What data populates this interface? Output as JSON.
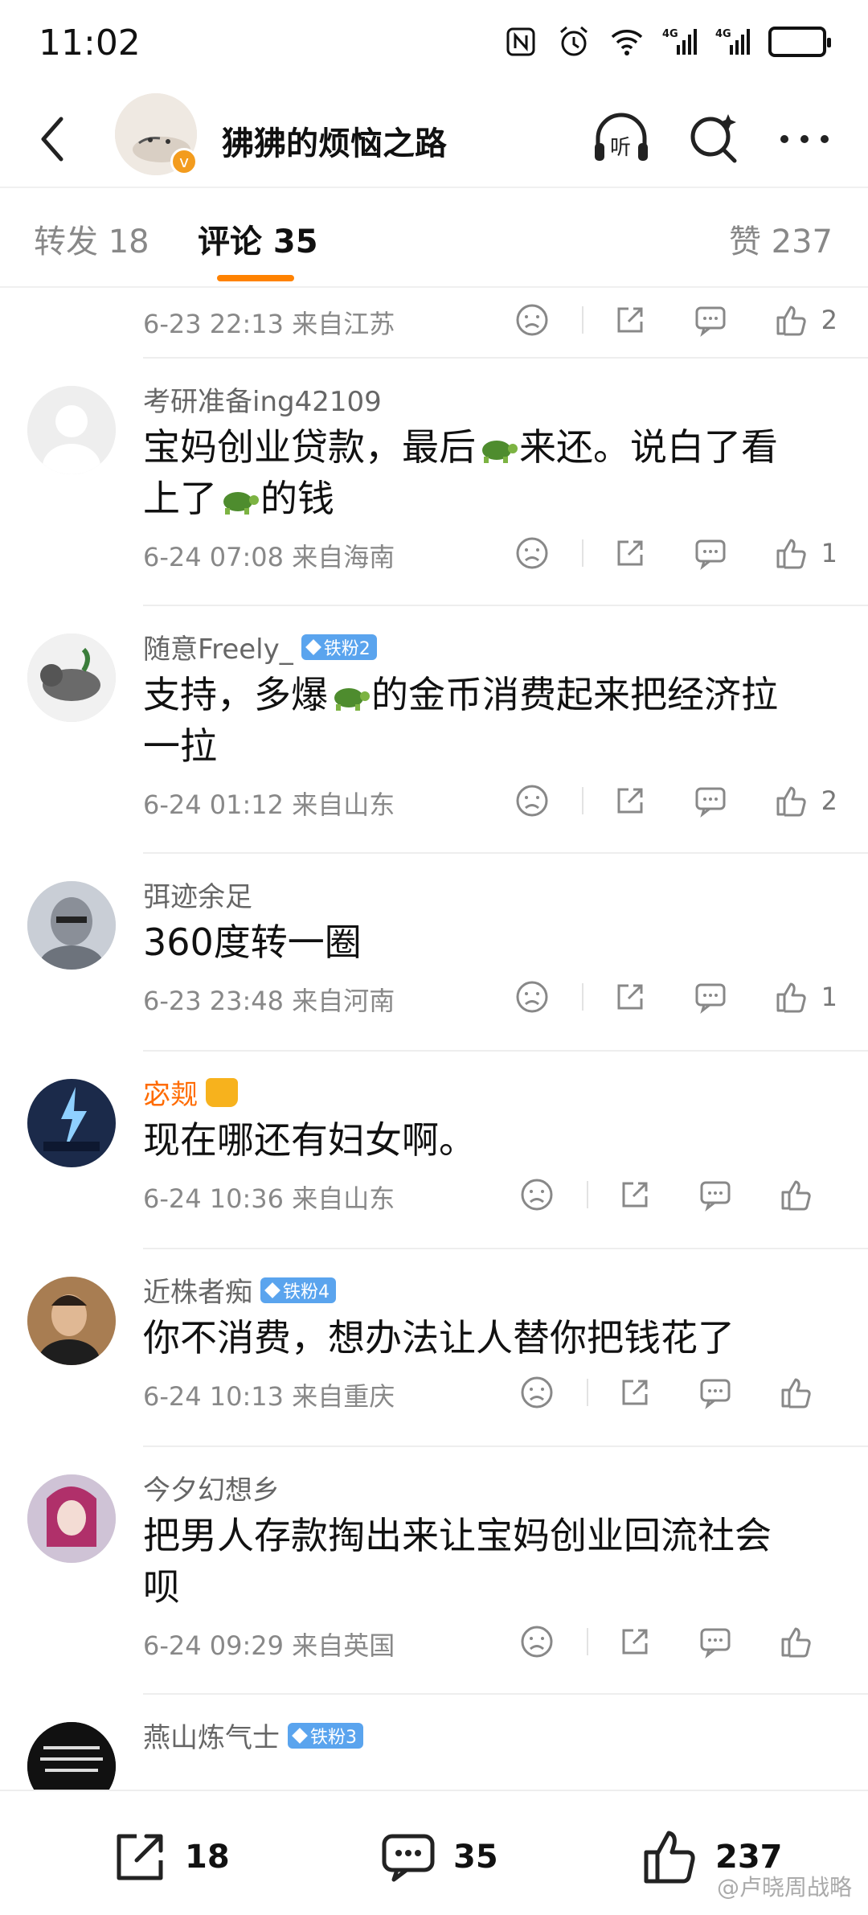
{
  "status_bar": {
    "time": "11:02"
  },
  "header": {
    "title": "狒狒的烦恼之路"
  },
  "tabs": {
    "repost": "转发 18",
    "comments": "评论 35",
    "likes": "赞 237"
  },
  "comments": [
    {
      "meta": "6-23 22:13 来自江苏",
      "likes": "2"
    },
    {
      "username": "考研准备ing42109",
      "text_parts": [
        "宝妈创业贷款，最后",
        "来还。说白了看",
        "上了",
        "的钱"
      ],
      "meta": "6-24 07:08 来自海南",
      "likes": "1"
    },
    {
      "username": "随意Freely_",
      "badge": "铁粉2",
      "text_parts": [
        "支持，多爆",
        "的金币消费起来把经济拉",
        "一拉"
      ],
      "meta": "6-24 01:12 来自山东",
      "likes": "2"
    },
    {
      "username": "弭迹余足",
      "text": "360度转一圈",
      "meta": "6-23 23:48 来自河南",
      "likes": "1"
    },
    {
      "username": "宓觌",
      "text": "现在哪还有妇女啊。",
      "meta": "6-24 10:36 来自山东",
      "likes": ""
    },
    {
      "username": "近株者痴",
      "badge": "铁粉4",
      "text": "你不消费，想办法让人替你把钱花了",
      "meta": "6-24 10:13 来自重庆",
      "likes": ""
    },
    {
      "username": "今夕幻想乡",
      "text_lines": [
        "把男人存款掏出来让宝妈创业回流社会",
        "呗"
      ],
      "meta": "6-24 09:29 来自英国",
      "likes": ""
    },
    {
      "username": "燕山炼气士",
      "badge": "铁粉3"
    }
  ],
  "bottom_bar": {
    "reposts": "18",
    "comments": "35",
    "likes": "237"
  },
  "watermark": "@卢晓周战略"
}
